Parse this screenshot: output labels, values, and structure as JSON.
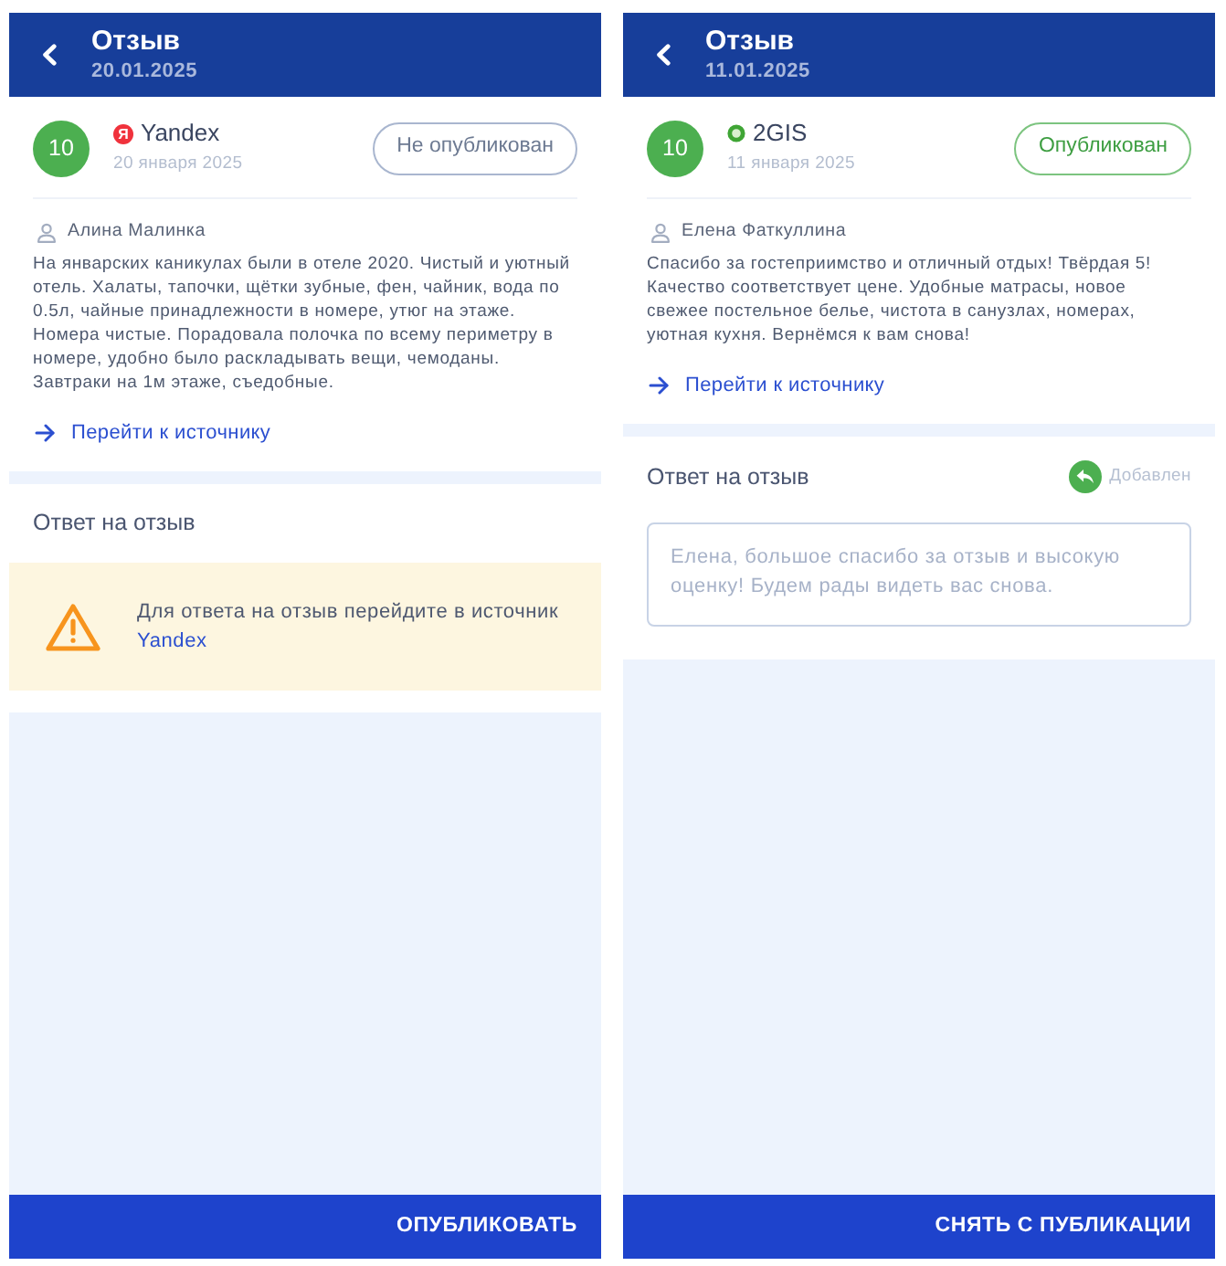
{
  "screens": [
    {
      "header": {
        "title": "Отзыв",
        "date": "20.01.2025"
      },
      "review": {
        "score": "10",
        "source": {
          "kind": "letter",
          "logo": "Я",
          "name": "Yandex"
        },
        "date": "20 января 2025",
        "status": {
          "label": "Не опубликован",
          "published": false
        },
        "author": "Алина Малинка",
        "text": "На январских каникулах были в отеле 2020. Чистый и уютный отель. Халаты, тапочки, щётки зубные, фен, чайник, вода по 0.5л, чайные принадлежности в номере, утюг на этаже. Номера чистые. Порадовала полочка по всему периметру в номере, удобно было раскладывать вещи, чемоданы. Завтраки на 1м этаже, съедобные.",
        "source_link": "Перейти к источнику"
      },
      "reply": {
        "title": "Ответ на отзыв",
        "kind": "notice",
        "notice_text": "Для ответа на отзыв перейдите в источник",
        "notice_link": "Yandex"
      },
      "action": "ОПУБЛИКОВАТЬ"
    },
    {
      "header": {
        "title": "Отзыв",
        "date": "11.01.2025"
      },
      "review": {
        "score": "10",
        "source": {
          "kind": "ring",
          "name": "2GIS"
        },
        "date": "11 января 2025",
        "status": {
          "label": "Опубликован",
          "published": true
        },
        "author": "Елена Фаткуллина",
        "text": "Спасибо за гостеприимство и отличный отдых! Твёрдая 5! Качество соответствует цене. Удобные матрасы, новое свежее постельное белье, чистота в санузлах, номерах, уютная кухня. Вернёмся к вам снова!",
        "source_link": "Перейти к источнику"
      },
      "reply": {
        "title": "Ответ на отзыв",
        "kind": "response",
        "badge": "Добавлен",
        "value": "Елена, большое спасибо за отзыв и высокую оценку! Будем рады видеть вас снова."
      },
      "action": "СНЯТЬ С ПУБЛИКАЦИИ"
    }
  ]
}
